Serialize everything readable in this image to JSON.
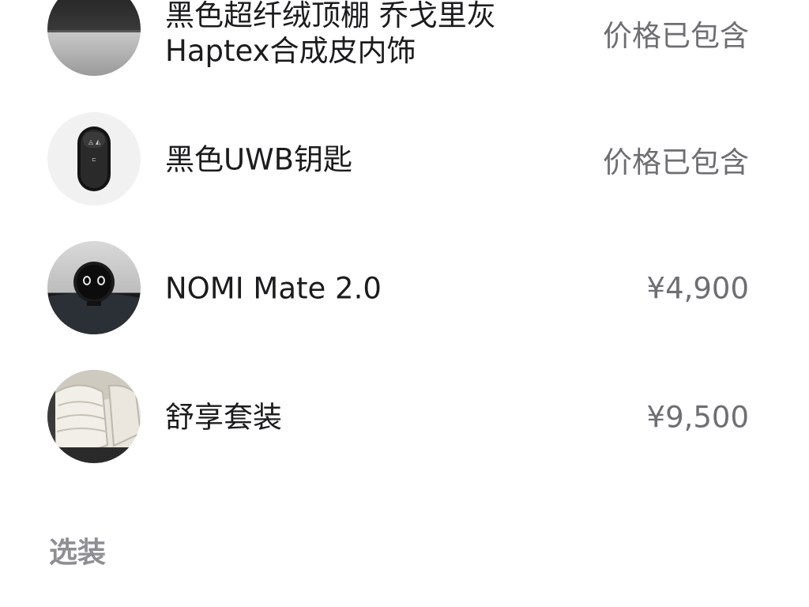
{
  "items": [
    {
      "title": "黑色超纤绒顶棚 乔戈里灰 Haptex合成皮内饰",
      "price": "价格已包含",
      "icon": "interior-material-thumbnail"
    },
    {
      "title": "黑色UWB钥匙",
      "price": "价格已包含",
      "icon": "uwb-key-thumbnail"
    },
    {
      "title": "NOMI Mate 2.0",
      "price": "¥4,900",
      "icon": "nomi-mate-thumbnail"
    },
    {
      "title": "舒享套装",
      "price": "¥9,500",
      "icon": "comfort-package-seat-thumbnail"
    }
  ],
  "section": {
    "heading": "选装"
  },
  "colors": {
    "text_primary": "#1c1c1e",
    "text_secondary": "#6e6e73",
    "section_heading": "#8e8e93",
    "background": "#ffffff"
  }
}
